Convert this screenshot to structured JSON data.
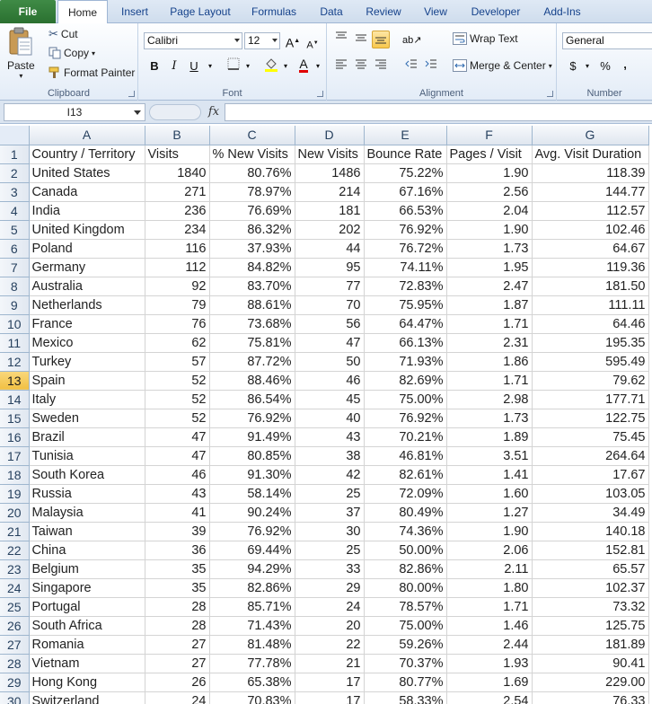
{
  "tabs": [
    "File",
    "Home",
    "Insert",
    "Page Layout",
    "Formulas",
    "Data",
    "Review",
    "View",
    "Developer",
    "Add-Ins"
  ],
  "ribbon": {
    "clipboard": {
      "label": "Clipboard",
      "paste": "Paste",
      "cut": "Cut",
      "copy": "Copy",
      "format_painter": "Format Painter"
    },
    "font": {
      "label": "Font",
      "name": "Calibri",
      "size": "12",
      "bold": "B",
      "italic": "I",
      "underline": "U",
      "grow": "A",
      "shrink": "A",
      "font_color": "A"
    },
    "alignment": {
      "label": "Alignment",
      "wrap_text": "Wrap Text",
      "merge_center": "Merge & Center"
    },
    "number": {
      "label": "Number",
      "format": "General",
      "currency": "$",
      "percent": "%",
      "comma": ","
    }
  },
  "formula_bar": {
    "name_box": "I13",
    "fx": "fx",
    "content": ""
  },
  "columns": [
    "A",
    "B",
    "C",
    "D",
    "E",
    "F",
    "G"
  ],
  "active_row": 13,
  "rows": [
    [
      "Country / Territory",
      "Visits",
      "% New Visits",
      "New Visits",
      "Bounce Rate",
      "Pages / Visit",
      "Avg. Visit Duration"
    ],
    [
      "United States",
      "1840",
      "80.76%",
      "1486",
      "75.22%",
      "1.90",
      "118.39"
    ],
    [
      "Canada",
      "271",
      "78.97%",
      "214",
      "67.16%",
      "2.56",
      "144.77"
    ],
    [
      "India",
      "236",
      "76.69%",
      "181",
      "66.53%",
      "2.04",
      "112.57"
    ],
    [
      "United Kingdom",
      "234",
      "86.32%",
      "202",
      "76.92%",
      "1.90",
      "102.46"
    ],
    [
      "Poland",
      "116",
      "37.93%",
      "44",
      "76.72%",
      "1.73",
      "64.67"
    ],
    [
      "Germany",
      "112",
      "84.82%",
      "95",
      "74.11%",
      "1.95",
      "119.36"
    ],
    [
      "Australia",
      "92",
      "83.70%",
      "77",
      "72.83%",
      "2.47",
      "181.50"
    ],
    [
      "Netherlands",
      "79",
      "88.61%",
      "70",
      "75.95%",
      "1.87",
      "111.11"
    ],
    [
      "France",
      "76",
      "73.68%",
      "56",
      "64.47%",
      "1.71",
      "64.46"
    ],
    [
      "Mexico",
      "62",
      "75.81%",
      "47",
      "66.13%",
      "2.31",
      "195.35"
    ],
    [
      "Turkey",
      "57",
      "87.72%",
      "50",
      "71.93%",
      "1.86",
      "595.49"
    ],
    [
      "Spain",
      "52",
      "88.46%",
      "46",
      "82.69%",
      "1.71",
      "79.62"
    ],
    [
      "Italy",
      "52",
      "86.54%",
      "45",
      "75.00%",
      "2.98",
      "177.71"
    ],
    [
      "Sweden",
      "52",
      "76.92%",
      "40",
      "76.92%",
      "1.73",
      "122.75"
    ],
    [
      "Brazil",
      "47",
      "91.49%",
      "43",
      "70.21%",
      "1.89",
      "75.45"
    ],
    [
      "Tunisia",
      "47",
      "80.85%",
      "38",
      "46.81%",
      "3.51",
      "264.64"
    ],
    [
      "South Korea",
      "46",
      "91.30%",
      "42",
      "82.61%",
      "1.41",
      "17.67"
    ],
    [
      "Russia",
      "43",
      "58.14%",
      "25",
      "72.09%",
      "1.60",
      "103.05"
    ],
    [
      "Malaysia",
      "41",
      "90.24%",
      "37",
      "80.49%",
      "1.27",
      "34.49"
    ],
    [
      "Taiwan",
      "39",
      "76.92%",
      "30",
      "74.36%",
      "1.90",
      "140.18"
    ],
    [
      "China",
      "36",
      "69.44%",
      "25",
      "50.00%",
      "2.06",
      "152.81"
    ],
    [
      "Belgium",
      "35",
      "94.29%",
      "33",
      "82.86%",
      "2.11",
      "65.57"
    ],
    [
      "Singapore",
      "35",
      "82.86%",
      "29",
      "80.00%",
      "1.80",
      "102.37"
    ],
    [
      "Portugal",
      "28",
      "85.71%",
      "24",
      "78.57%",
      "1.71",
      "73.32"
    ],
    [
      "South Africa",
      "28",
      "71.43%",
      "20",
      "75.00%",
      "1.46",
      "125.75"
    ],
    [
      "Romania",
      "27",
      "81.48%",
      "22",
      "59.26%",
      "2.44",
      "181.89"
    ],
    [
      "Vietnam",
      "27",
      "77.78%",
      "21",
      "70.37%",
      "1.93",
      "90.41"
    ],
    [
      "Hong Kong",
      "26",
      "65.38%",
      "17",
      "80.77%",
      "1.69",
      "229.00"
    ],
    [
      "Switzerland",
      "24",
      "70.83%",
      "17",
      "58.33%",
      "2.54",
      "76.33"
    ]
  ],
  "colors": {
    "file_tab": "#2a7030",
    "active_row_header": "#f1c043",
    "header_text": "#27415f"
  }
}
